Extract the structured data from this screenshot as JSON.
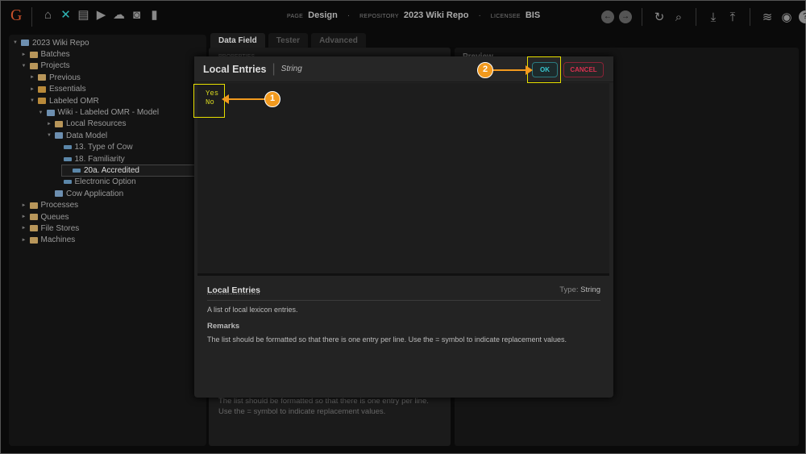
{
  "app": {
    "logo": "G"
  },
  "toolbar": {
    "icons": [
      "home-icon",
      "tools-icon",
      "archive-icon",
      "media-icon",
      "cloud-upload-icon",
      "briefcase-clock-icon",
      "bar-chart-icon"
    ]
  },
  "breadcrumb": {
    "page_label": "PAGE",
    "page": "Design",
    "repo_label": "REPOSITORY",
    "repo": "2023 Wiki Repo",
    "licensee_label": "LICENSEE",
    "licensee": "BIS"
  },
  "tree": [
    {
      "label": "2023 Wiki Repo",
      "level": 0,
      "toggle": "▼",
      "icon": "repo"
    },
    {
      "label": "Batches",
      "level": 1,
      "toggle": "►",
      "icon": "folder"
    },
    {
      "label": "Projects",
      "level": 1,
      "toggle": "▼",
      "icon": "folder"
    },
    {
      "label": "Previous",
      "level": 2,
      "toggle": "►",
      "icon": "folder"
    },
    {
      "label": "Essentials",
      "level": 2,
      "toggle": "►",
      "icon": "pkg"
    },
    {
      "label": "Labeled OMR",
      "level": 2,
      "toggle": "▼",
      "icon": "pkg"
    },
    {
      "label": "Wiki - Labeled OMR - Model",
      "level": 3,
      "toggle": "▼",
      "icon": "repo"
    },
    {
      "label": "Local Resources",
      "level": 4,
      "toggle": "►",
      "icon": "folder"
    },
    {
      "label": "Data Model",
      "level": 4,
      "toggle": "▼",
      "icon": "repo"
    },
    {
      "label": "13. Type of Cow",
      "level": 5,
      "toggle": "",
      "icon": "field"
    },
    {
      "label": "18. Familiarity",
      "level": 5,
      "toggle": "",
      "icon": "field"
    },
    {
      "label": "20a. Accredited",
      "level": 5,
      "toggle": "",
      "icon": "field",
      "selected": true
    },
    {
      "label": "Electronic Option",
      "level": 5,
      "toggle": "",
      "icon": "field"
    },
    {
      "label": "Cow Application",
      "level": 4,
      "toggle": "",
      "icon": "repo"
    },
    {
      "label": "Processes",
      "level": 1,
      "toggle": "►",
      "icon": "folder"
    },
    {
      "label": "Queues",
      "level": 1,
      "toggle": "►",
      "icon": "folder"
    },
    {
      "label": "File Stores",
      "level": 1,
      "toggle": "►",
      "icon": "folder"
    },
    {
      "label": "Machines",
      "level": 1,
      "toggle": "►",
      "icon": "folder"
    }
  ],
  "tabs": [
    "Data Field",
    "Tester",
    "Advanced"
  ],
  "middle": {
    "properties": "PROPERTIES",
    "bg_text": "The list should be formatted so that there is one entry per line. Use the = symbol to indicate replacement values."
  },
  "preview": {
    "title": "Preview"
  },
  "modal": {
    "title": "Local Entries",
    "type": "String",
    "ok": "OK",
    "cancel": "CANCEL",
    "value": "Yes\nNo",
    "help": {
      "title": "Local Entries",
      "type_label": "Type:",
      "type": "String",
      "description": "A list of local lexicon entries.",
      "remarks_title": "Remarks",
      "remarks": "The list should be formatted so that there is one entry per line. Use the = symbol to indicate replacement values."
    }
  },
  "callouts": [
    "1",
    "2"
  ],
  "colors": {
    "accent": "#2fb4b4",
    "callout": "#f29a1e",
    "highlight": "#e8e000",
    "cancel": "#d83050"
  }
}
